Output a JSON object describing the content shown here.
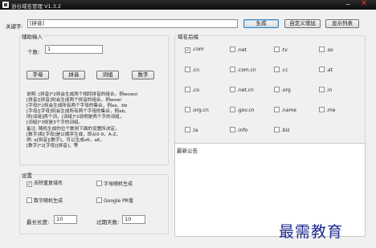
{
  "window": {
    "title": "浙谷域名管理 V1.3.2",
    "minimize_glyph": "−",
    "close_glyph": "✕"
  },
  "keyword": {
    "label": "关键字:",
    "value": "[拼音]"
  },
  "toolbar": {
    "generate_label": "生成",
    "custom_add_label": "自定义增加",
    "show_list_label": "显示列表"
  },
  "aux_input": {
    "legend": "辅助输入",
    "count_label": "个数:",
    "count_value": "1",
    "buttons": [
      "字母",
      "拼音",
      "词组",
      "数字"
    ],
    "description": [
      "说明: [拼音]*2则会生成两个相同拼音的组合，例wowoi",
      "      [拼音][拼音]则会生成两个拼音的组合，例wowi",
      "      [字母]*2则会生成所有两个字母的集合，例aa、bb",
      "      [字母][字母]则会生成所有两个字母的集合，例ab、",
      "      所[词组]两个词，[词组]*2说明是两个字的词组，",
      "      [词组]*3则是3个字的词组。",
      "备注: 随机生成的位个数则下面的设置所决定。",
      "      [数字]和[字母]是以顺序生成，即从0-9，A-Z，",
      "例:   a[拼音][数字]，可以生成o6，a6，",
      "      [数字]*2[字母][拼音]，等"
    ]
  },
  "domain_suffix": {
    "legend": "域名后缀",
    "items": [
      {
        "label": ".com",
        "checked": true
      },
      {
        "label": ".net",
        "checked": false
      },
      {
        "label": ".tv",
        "checked": false
      },
      {
        "label": ".so",
        "checked": false
      },
      {
        "label": ".cn",
        "checked": false
      },
      {
        "label": ".com.cn",
        "checked": false
      },
      {
        "label": ".cc",
        "checked": false
      },
      {
        "label": ".at",
        "checked": false
      },
      {
        "label": ".co",
        "checked": false
      },
      {
        "label": ".net.cn",
        "checked": false
      },
      {
        "label": ".org",
        "checked": false
      },
      {
        "label": ".in",
        "checked": false
      },
      {
        "label": ".org.cn",
        "checked": false
      },
      {
        "label": ".gov.cn",
        "checked": false
      },
      {
        "label": ".name",
        "checked": false
      },
      {
        "label": ".me",
        "checked": false
      },
      {
        "label": ".la",
        "checked": false
      },
      {
        "label": ".info",
        "checked": false
      },
      {
        "label": ".biz",
        "checked": false
      }
    ]
  },
  "settings": {
    "legend": "设置",
    "dedupe_label": "去除重复域名",
    "dedupe_checked": true,
    "random_letters_label": "字母随机生成",
    "random_letters_checked": false,
    "random_numbers_label": "数字随机生成",
    "random_numbers_checked": false,
    "google_pr_label": "Google PR值",
    "google_pr_checked": false,
    "max_length_label": "最长长度:",
    "max_length_value": "10",
    "expire_days_label": "过期天数:",
    "expire_days_value": "10"
  },
  "announcement": {
    "title": "最新公告"
  },
  "watermark": "最需教育",
  "icons": {
    "check": "✓"
  }
}
